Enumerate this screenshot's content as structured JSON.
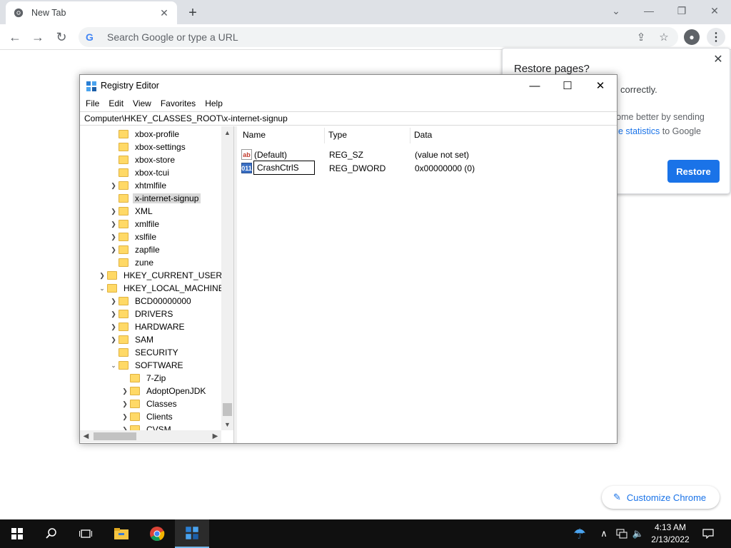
{
  "browser": {
    "tab_title": "New Tab",
    "omnibox_placeholder": "Search Google or type a URL",
    "restore_popup": {
      "title": "Restore pages?",
      "message_line1": "correctly.",
      "message_line2": "rome better by sending",
      "message_line3_link": "ge statistics",
      "message_line3_rest": " to Google",
      "button_label": "Restore"
    },
    "customize_label": "Customize Chrome",
    "colors": {
      "accent": "#1a73e8",
      "tabstrip": "#dee1e6"
    }
  },
  "regedit": {
    "title": "Registry Editor",
    "menu": [
      "File",
      "Edit",
      "View",
      "Favorites",
      "Help"
    ],
    "address": "Computer\\HKEY_CLASSES_ROOT\\x-internet-signup",
    "tree": [
      {
        "label": "xbox-profile",
        "level": 3,
        "expander": ""
      },
      {
        "label": "xbox-settings",
        "level": 3,
        "expander": ""
      },
      {
        "label": "xbox-store",
        "level": 3,
        "expander": ""
      },
      {
        "label": "xbox-tcui",
        "level": 3,
        "expander": ""
      },
      {
        "label": "xhtmlfile",
        "level": 3,
        "expander": ">"
      },
      {
        "label": "x-internet-signup",
        "level": 3,
        "expander": "",
        "selected": true
      },
      {
        "label": "XML",
        "level": 3,
        "expander": ">"
      },
      {
        "label": "xmlfile",
        "level": 3,
        "expander": ">"
      },
      {
        "label": "xslfile",
        "level": 3,
        "expander": ">"
      },
      {
        "label": "zapfile",
        "level": 3,
        "expander": ">"
      },
      {
        "label": "zune",
        "level": 3,
        "expander": ""
      },
      {
        "label": "HKEY_CURRENT_USER",
        "level": 2,
        "expander": ">"
      },
      {
        "label": "HKEY_LOCAL_MACHINE",
        "level": 2,
        "expander": "v"
      },
      {
        "label": "BCD00000000",
        "level": 3,
        "expander": ">"
      },
      {
        "label": "DRIVERS",
        "level": 3,
        "expander": ">"
      },
      {
        "label": "HARDWARE",
        "level": 3,
        "expander": ">"
      },
      {
        "label": "SAM",
        "level": 3,
        "expander": ">"
      },
      {
        "label": "SECURITY",
        "level": 3,
        "expander": ""
      },
      {
        "label": "SOFTWARE",
        "level": 3,
        "expander": "v"
      },
      {
        "label": "7-Zip",
        "level": 4,
        "expander": ""
      },
      {
        "label": "AdoptOpenJDK",
        "level": 4,
        "expander": ">"
      },
      {
        "label": "Classes",
        "level": 4,
        "expander": ">"
      },
      {
        "label": "Clients",
        "level": 4,
        "expander": ">"
      },
      {
        "label": "CVSM",
        "level": 4,
        "expander": ">"
      }
    ],
    "columns": {
      "name": "Name",
      "type": "Type",
      "data": "Data"
    },
    "values": [
      {
        "icon": "ab",
        "name": "(Default)",
        "type": "REG_SZ",
        "data": "(value not set)"
      },
      {
        "icon": "011",
        "name": "CrashCtrlS",
        "type": "REG_DWORD",
        "data": "0x00000000 (0)",
        "editing": true
      }
    ]
  },
  "taskbar": {
    "time": "4:13 AM",
    "date": "2/13/2022"
  }
}
